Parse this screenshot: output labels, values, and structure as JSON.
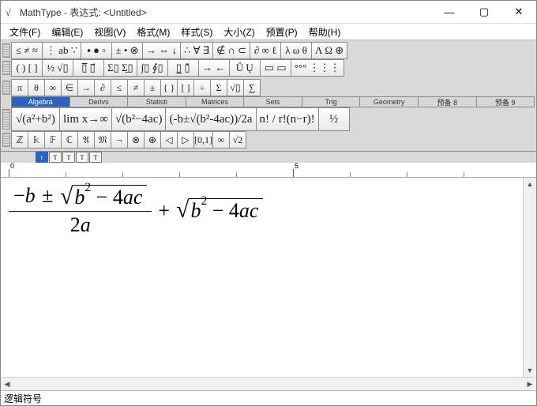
{
  "window": {
    "app_icon": "√",
    "title": "MathType - 表达式: <Untitled>"
  },
  "menus": [
    "文件(F)",
    "编辑(E)",
    "视图(V)",
    "格式(M)",
    "样式(S)",
    "大小(Z)",
    "预置(P)",
    "帮助(H)"
  ],
  "toolbar_symbols_row1": [
    "≤ ≠ ≈",
    "⋮ ab ∵",
    "▪ ● ▫",
    "± • ⊗",
    "→ ⇔ ↓",
    "∴ ∀ ∃",
    "∉ ∩ ⊂",
    "∂ ∞ ℓ",
    "λ ω θ",
    "Λ Ω ⊕"
  ],
  "toolbar_symbols_row2": [
    "( ) [ ]",
    "½  √▯",
    "▯̅  ▯⃗",
    "Σ▯ Σ̲▯",
    "∫▯ ∮▯",
    "▯̲ ▯̄",
    "→ ←",
    "Ů  Ų",
    "▭ ▭",
    "°°°  ⋮⋮⋮"
  ],
  "toolbar_palette_row": [
    "π",
    "θ",
    "∞",
    "∈",
    "→",
    "∂",
    "≤",
    "≠",
    "±",
    "{ }",
    "[ ]",
    "÷",
    "Σ",
    "√▯",
    "∑"
  ],
  "toolbar_tabs": [
    "Algebra",
    "Derivs",
    "Statisti",
    "Matrices",
    "Sets",
    "Trig",
    "Geometry",
    "预备 8",
    "预备 9"
  ],
  "toolbar_big": [
    "√(a²+b²)",
    "lim x→∞",
    "√(b²−4ac)",
    "(-b±√(b²-4ac))/2a",
    "n! / r!(n−r)!",
    "½"
  ],
  "toolbar_bottom": [
    "ℤ",
    "𝕜",
    "𝔽",
    "ℂ",
    "𝔄",
    "𝔐",
    "¬",
    "⊗",
    "⊕",
    "◁",
    "▷",
    "[0,1]",
    "∞",
    "√2"
  ],
  "minitabs": [
    "t",
    "T",
    "T",
    "T",
    "T"
  ],
  "ruler": {
    "m0": "0",
    "m1": "5"
  },
  "equation": {
    "num_lead": "−",
    "var_b": "b",
    "pm": "±",
    "rad1_b": "b",
    "rad1_exp": "2",
    "rad1_rest": " − 4",
    "rad1_a": "ac",
    "den_two": "2",
    "den_a": "a",
    "plus": "+",
    "rad2_b": "b",
    "rad2_exp": "2",
    "rad2_rest": " − 4",
    "rad2_a": "ac"
  },
  "status": "逻辑符号"
}
